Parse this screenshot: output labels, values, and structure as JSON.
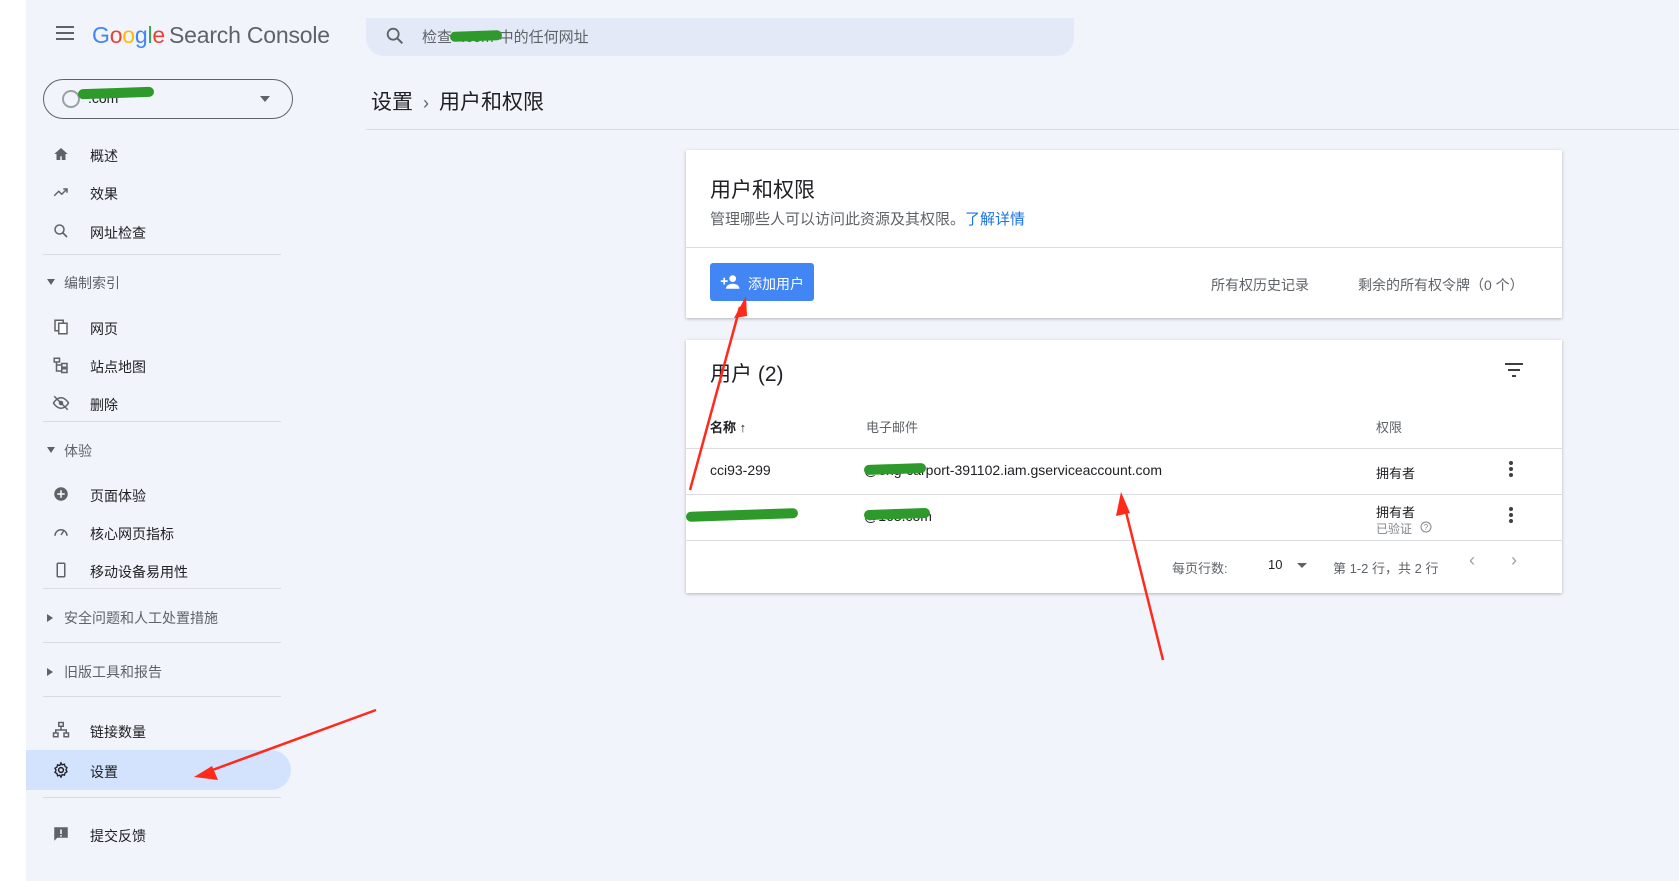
{
  "header": {
    "logo_google": [
      "G",
      "o",
      "o",
      "g",
      "l",
      "e"
    ],
    "logo_product": "Search Console",
    "search_placeholder": "检查“        .com”中的任何网址"
  },
  "property": {
    "name": "        .com"
  },
  "sidebar": {
    "overview": "概述",
    "performance": "效果",
    "url_inspection": "网址检查",
    "section_indexing": "编制索引",
    "pages": "网页",
    "sitemaps": "站点地图",
    "removals": "删除",
    "section_experience": "体验",
    "page_experience": "页面体验",
    "core_web_vitals": "核心网页指标",
    "mobile_usability": "移动设备易用性",
    "section_security": "安全问题和人工处置措施",
    "section_legacy": "旧版工具和报告",
    "links": "链接数量",
    "settings": "设置",
    "feedback": "提交反馈"
  },
  "breadcrumb": {
    "parent": "设置",
    "separator": "›",
    "current": "用户和权限"
  },
  "permissions_card": {
    "title": "用户和权限",
    "description": "管理哪些人可以访问此资源及其权限。",
    "learn_more": "了解详情",
    "add_user": "添加用户",
    "history": "所有权历史记录",
    "tokens": "剩余的所有权令牌（0 个）"
  },
  "users_card": {
    "title": "用户 (2)",
    "columns": {
      "name": "名称",
      "sort_arrow": "↑",
      "email": "电子邮件",
      "permission": "权限"
    },
    "rows": [
      {
        "name": "cci93-299",
        "email": "         @eng-carport-391102.iam.gserviceaccount.com",
        "permission": "拥有者",
        "status": ""
      },
      {
        "name": "",
        "email": "             @163.com",
        "permission": "拥有者",
        "status": "已验证"
      }
    ],
    "pager": {
      "rows_label": "每页行数:",
      "rows_value": "10",
      "range": "第 1-2 行，共 2 行"
    }
  },
  "colors": {
    "accent": "#4285f4",
    "active_nav": "#d3e3fd",
    "annotation": "#ff2a1a",
    "redaction": "#2e9a2b"
  }
}
